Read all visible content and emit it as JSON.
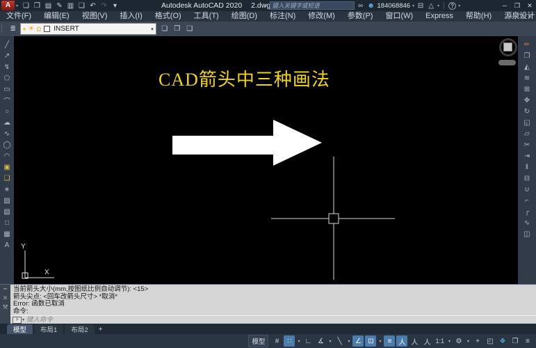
{
  "titlebar": {
    "app_title": "Autodesk AutoCAD 2020",
    "doc_title": "2.dwg",
    "search_placeholder": "键入关键字或短语",
    "user_id": "184068846"
  },
  "menubar": {
    "items": [
      "文件(F)",
      "编辑(E)",
      "视图(V)",
      "插入(I)",
      "格式(O)",
      "工具(T)",
      "绘图(D)",
      "标注(N)",
      "修改(M)",
      "参数(P)",
      "窗口(W)",
      "Express",
      "帮助(H)",
      "源泉设计"
    ]
  },
  "layer_toolbar": {
    "current_layer": "INSERT"
  },
  "drawing": {
    "heading": "CAD箭头中三种画法",
    "ucs_x": "X",
    "ucs_y": "Y"
  },
  "command_panel": {
    "history": [
      "当前箭头大小(mm,按图纸比例自动调节): <15>",
      "箭头尖点: <回车改箭头尺寸> *取消*",
      "Error: 函数已取消",
      "命令:"
    ],
    "input_placeholder": "键入命令"
  },
  "layout_tabs": {
    "model": "模型",
    "layout1": "布局1",
    "layout2": "布局2",
    "add": "+"
  },
  "statusbar": {
    "model_label": "模型",
    "annotation_scale": "1:1"
  },
  "glyphs": {
    "logo": "A",
    "caret": "▾",
    "caret_right": "▸",
    "new": "❏",
    "open": "❒",
    "save": "▤",
    "saveas": "✎",
    "plot": "▥",
    "print": "❑",
    "undo": "↶",
    "redo": "↷",
    "minimize": "─",
    "restore": "❐",
    "close": "✕",
    "binoculars": "∞",
    "person": "☻",
    "cart": "⊟",
    "share_triangle": "△",
    "help": "?",
    "grip": "▏",
    "layer_props": "≣",
    "bulb": "●",
    "sun": "☀",
    "lock": "Ω",
    "layer_tool1": "❏",
    "layer_tool2": "❐",
    "layer_tool3": "❑",
    "line": "╱",
    "xline": "↗",
    "pline": "↯",
    "polygon": "⬠",
    "rect": "▭",
    "arc": "⌒",
    "circle": "○",
    "revcloud": "☁",
    "spline": "∿",
    "ellipse": "◯",
    "earc": "◠",
    "insblock": "▣",
    "mkblock": "❑",
    "point": "∗",
    "hatch": "▨",
    "gradient": "▧",
    "region": "□",
    "table": "▦",
    "mtext": "A",
    "erase": "✏",
    "copy": "❐",
    "mirror": "◭",
    "offset": "≋",
    "array": "⊞",
    "move": "✥",
    "rotate": "↻",
    "scale": "◱",
    "stretch": "▱",
    "trim": "✂",
    "extend": "⇥",
    "breakpt": "‖",
    "brk": "⊟",
    "join": "∪",
    "chamfer": "⌐",
    "fillet": "╭",
    "blend": "∿",
    "explode": "◫",
    "cmd_grip": "┅",
    "cmd_close": "✕",
    "wrench": "⚒",
    "prompt": ">",
    "grid": "#",
    "snap": "∷",
    "ortho": "∟",
    "polar": "∡",
    "isodraft": "╲",
    "otrack": "∠",
    "osnap": "⊡",
    "lineweight": "≡",
    "annovis": "人",
    "annoauto": "人",
    "annomon": "人",
    "gear": "⚙",
    "plus": "+",
    "isolate": "◰",
    "hardware": "❖",
    "cleanscreen": "❐",
    "sbmenu": "≡"
  }
}
